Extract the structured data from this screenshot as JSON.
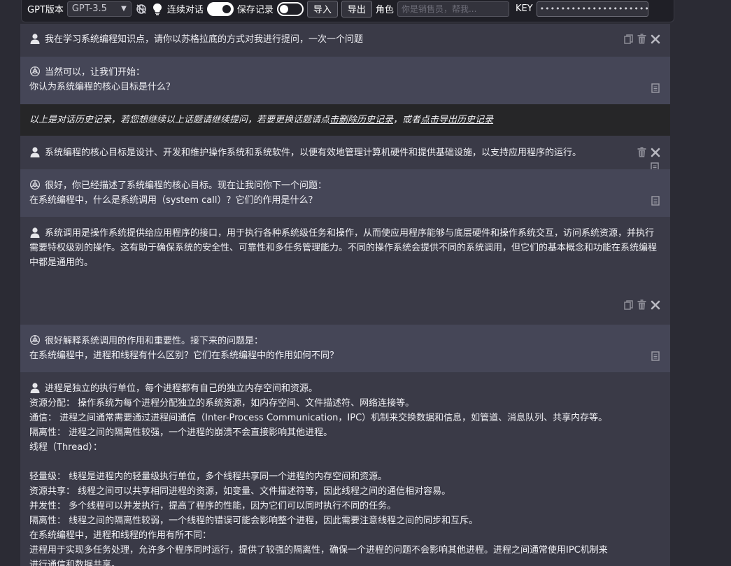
{
  "toolbar": {
    "version_label": "GPT版本",
    "version_value": "GPT-3.5",
    "continuous_label": "连续对话",
    "continuous_on": true,
    "save_label": "保存记录",
    "save_on": false,
    "import_label": "导入",
    "export_label": "导出",
    "role_label": "角色",
    "role_placeholder": "你是销售员，帮我...",
    "key_label": "KEY",
    "key_value": "•••••••••••••••••••••••••••••••••••••••"
  },
  "messages": {
    "m1": {
      "text": "我在学习系统编程知识点，请你以苏格拉底的方式对我进行提问，一次一个问题"
    },
    "m2": {
      "line1": "当然可以，让我们开始：",
      "line2": "你认为系统编程的核心目标是什么？"
    },
    "notice": {
      "before": "以上是对话历史记录，若您想继续以上话题请继续提问，若要更换话题请点",
      "link1": "击删除历史记录",
      "middle": "，或者",
      "link2": "点击导出历史记录"
    },
    "m3": {
      "text": "系统编程的核心目标是设计、开发和维护操作系统和系统软件，以便有效地管理计算机硬件和提供基础设施，以支持应用程序的运行。"
    },
    "m4": {
      "line1": "很好，你已经描述了系统编程的核心目标。现在让我问你下一个问题：",
      "line2": "在系统编程中，什么是系统调用（system call）？它们的作用是什么？"
    },
    "m5": {
      "text": "系统调用是操作系统提供给应用程序的接口，用于执行各种系统级任务和操作，从而使应用程序能够与底层硬件和操作系统交互，访问系统资源，并执行需要特权级别的操作。这有助于确保系统的安全性、可靠性和多任务管理能力。不同的操作系统会提供不同的系统调用，但它们的基本概念和功能在系统编程中都是通用的。"
    },
    "m6": {
      "line1": "很好解释系统调用的作用和重要性。接下来的问题是：",
      "line2": "在系统编程中，进程和线程有什么区别？它们在系统编程中的作用如何不同？"
    },
    "m7": {
      "lines": [
        "进程是独立的执行单位，每个进程都有自己的独立内存空间和资源。",
        "资源分配： 操作系统为每个进程分配独立的系统资源，如内存空间、文件描述符、网络连接等。",
        "通信： 进程之间通常需要通过进程间通信（Inter-Process Communication，IPC）机制来交换数据和信息，如管道、消息队列、共享内存等。",
        "隔离性： 进程之间的隔离性较强，一个进程的崩溃不会直接影响其他进程。",
        "线程（Thread）：",
        "",
        "轻量级： 线程是进程内的轻量级执行单位，多个线程共享同一个进程的内存空间和资源。",
        "资源共享： 线程之间可以共享相同进程的资源，如变量、文件描述符等，因此线程之间的通信相对容易。",
        "并发性： 多个线程可以并发执行，提高了程序的性能，因为它们可以同时执行不同的任务。",
        "隔离性： 线程之间的隔离性较弱，一个线程的错误可能会影响整个进程，因此需要注意线程之间的同步和互斥。",
        "在系统编程中，进程和线程的作用有所不同：",
        "进程用于实现多任务处理，允许多个程序同时运行，提供了较强的隔离性，确保一个进程的问题不会影响其他进程。进程之间通常使用IPC机制来",
        "进行通信和数据共享。"
      ]
    }
  }
}
